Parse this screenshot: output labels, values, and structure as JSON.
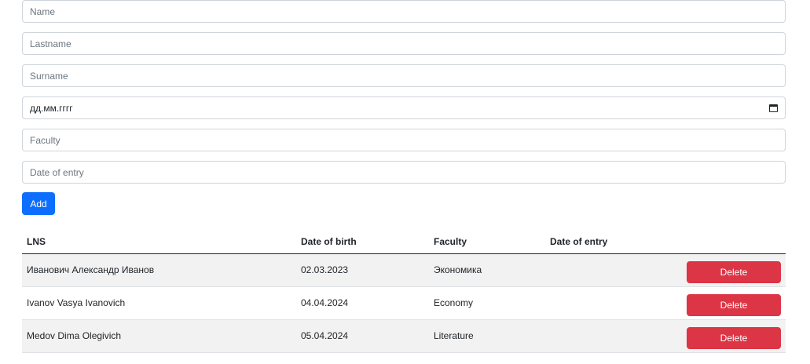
{
  "form": {
    "name_placeholder": "Name",
    "lastname_placeholder": "Lastname",
    "surname_placeholder": "Surname",
    "birth_date_placeholder": "дд.мм.гггг",
    "faculty_placeholder": "Faculty",
    "entry_date_placeholder": "Date of entry",
    "add_label": "Add",
    "calendar_icon": "calendar-icon"
  },
  "table": {
    "headers": {
      "lns": "LNS",
      "dob": "Date of birth",
      "faculty": "Faculty",
      "entry": "Date of entry"
    },
    "rows": [
      {
        "lns": "Иванович Александр Иванов",
        "dob": "02.03.2023",
        "faculty": "Экономика",
        "entry": "",
        "action": "Delete"
      },
      {
        "lns": "Ivanov Vasya Ivanovich",
        "dob": "04.04.2024",
        "faculty": "Economy",
        "entry": "",
        "action": "Delete"
      },
      {
        "lns": "Medov Dima Olegivich",
        "dob": "05.04.2024",
        "faculty": "Literature",
        "entry": "",
        "action": "Delete"
      }
    ]
  },
  "colors": {
    "primary": "#0d6efd",
    "danger": "#dc3545",
    "stripe": "#f2f2f2"
  }
}
